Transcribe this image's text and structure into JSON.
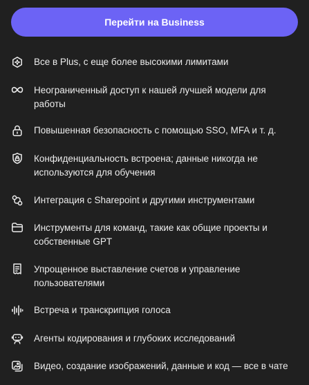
{
  "cta": {
    "label": "Перейти на Business"
  },
  "colors": {
    "background": "#202020",
    "accent": "#6c63f5",
    "text": "#ececec"
  },
  "features": [
    {
      "icon": "sparkle-badge-icon",
      "text": "Все в Plus, с еще более высокими лимитами"
    },
    {
      "icon": "infinity-icon",
      "text": "Неограниченный доступ к нашей лучшей модели для работы"
    },
    {
      "icon": "lock-icon",
      "text": "Повышенная безопасность с помощью SSO, MFA и т. д."
    },
    {
      "icon": "shield-lock-icon",
      "text": "Конфиденциальность встроена; данные никогда не используются для обучения"
    },
    {
      "icon": "integration-icon",
      "text": "Интеграция с Sharepoint и другими инструментами"
    },
    {
      "icon": "folder-icon",
      "text": "Инструменты для команд, такие как общие проекты и собственные GPT"
    },
    {
      "icon": "invoice-icon",
      "text": "Упрощенное выставление счетов и управление пользователями"
    },
    {
      "icon": "voice-waveform-icon",
      "text": "Встреча и транскрипция голоса"
    },
    {
      "icon": "agent-robot-icon",
      "text": "Агенты кодирования и глубоких исследований"
    },
    {
      "icon": "media-chat-icon",
      "text": "Видео, создание изображений, данные и код — все в чате"
    }
  ]
}
